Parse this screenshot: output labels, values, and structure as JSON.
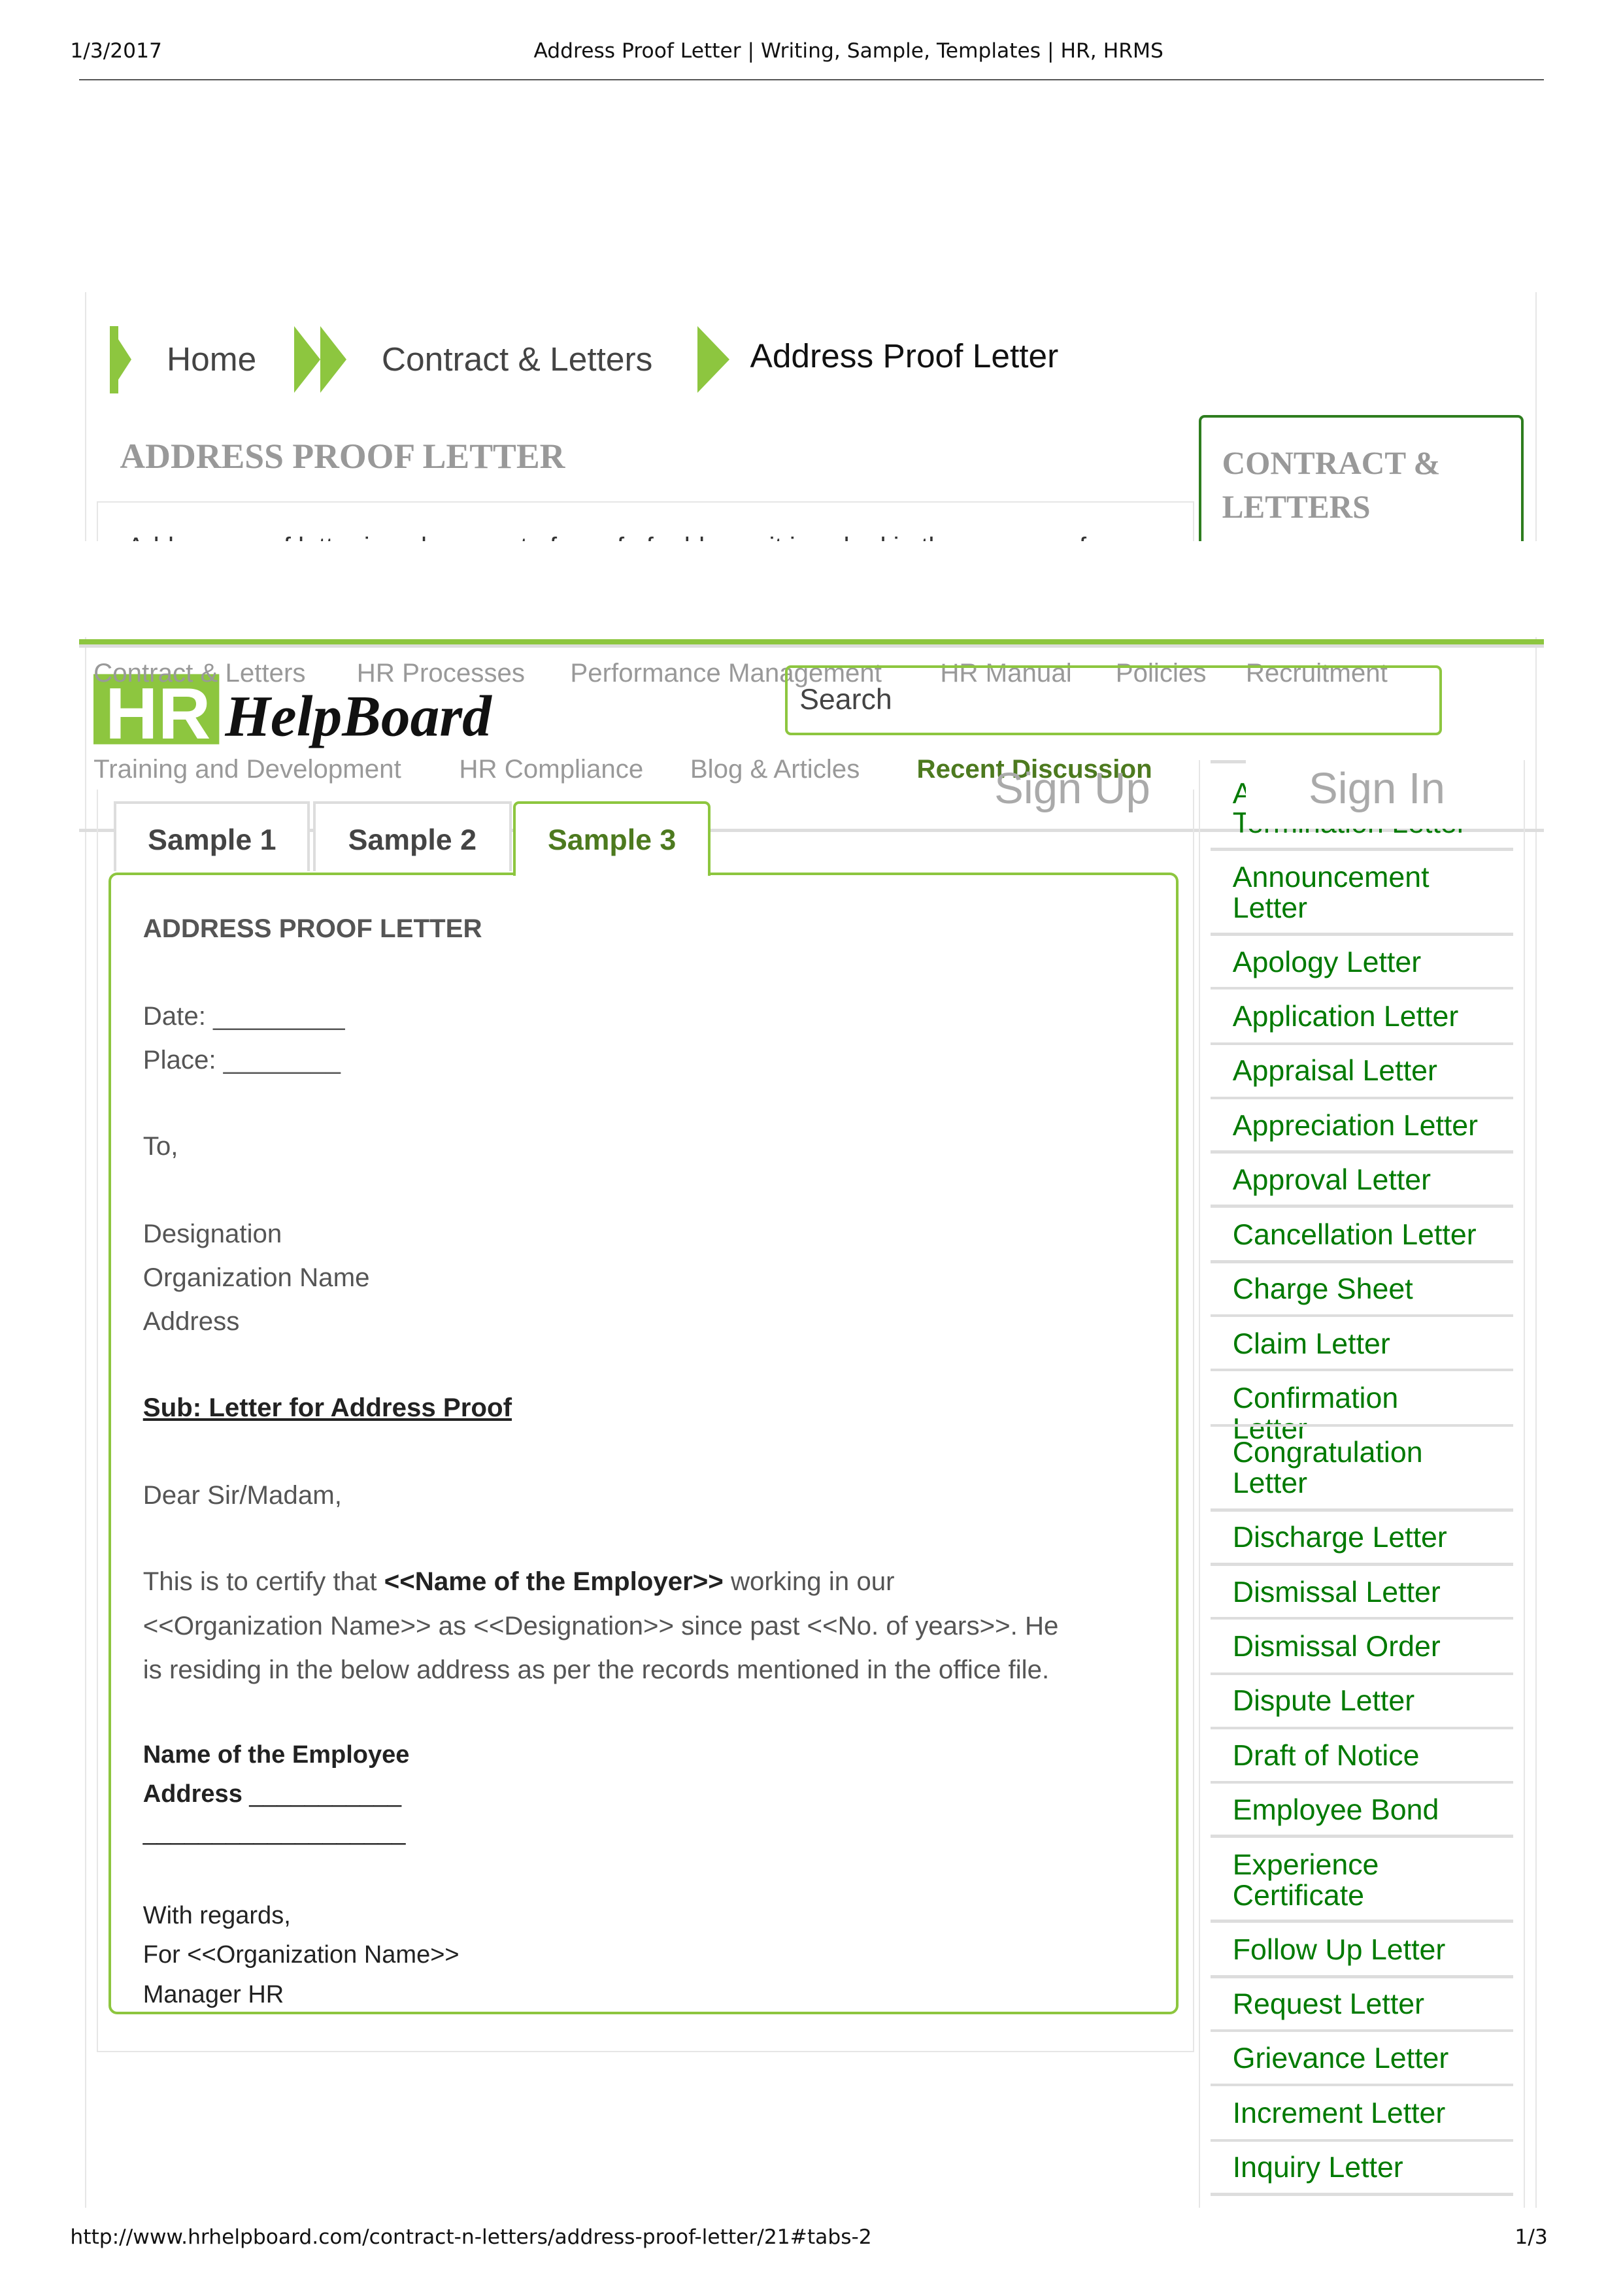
{
  "print_header": {
    "date": "1/3/2017",
    "title": "Address Proof Letter | Writing, Sample, Templates | HR, HRMS"
  },
  "breadcrumb": {
    "items": [
      "Home",
      "Contract & Letters",
      "Address Proof Letter"
    ]
  },
  "page_title": "ADDRESS PROOF LETTER",
  "intro_snippet": "Address proof letter is a document of proof of address, it is asked in the process of",
  "sidebar_title": "CONTRACT & LETTERS",
  "nav": {
    "row1": [
      "Contract & Letters",
      "HR Processes",
      "Performance Management",
      "HR Manual",
      "Policies",
      "Recruitment"
    ],
    "row2": [
      "Training and Development",
      "HR Compliance",
      "Blog & Articles",
      "Recent Discussion"
    ],
    "logo": "HR HelpBoard",
    "search_placeholder": "Search",
    "sign_up": "Sign Up",
    "sign_in": "Sign In"
  },
  "colors": {
    "brand_green": "#8dc63f",
    "link_green": "#007a00",
    "active_tab": "#4d7a1f"
  },
  "tabs": [
    "Sample 1",
    "Sample 2",
    "Sample 3"
  ],
  "active_tab": "Sample 3",
  "letter": {
    "heading": "ADDRESS PROOF LETTER",
    "date": "Date: _________",
    "place": "Place: ________",
    "to": "To,",
    "designation": "Designation",
    "org": "Organization Name",
    "address": "Address",
    "subject": "Sub: Letter for Address Proof",
    "salutation": "Dear Sir/Madam,",
    "body_pre": "This is to certify that ",
    "body_bold": "<<Name of the Employer>>",
    "body_post": " working in our",
    "body_line2": "<<Organization Name>> as <<Designation>> since past <<No. of years>>. He",
    "body_line3": "is residing in the below address as per the records mentioned in the office file.",
    "emp_name": "Name of the Employee",
    "emp_address": "Address",
    "emp_address_blank": " ___________",
    "blank_line": "___________________",
    "regards": "With regards,",
    "for_org": "For <<Organization Name>>",
    "signatory": "Manager HR"
  },
  "sidebar_items": [
    "A",
    "Termination Letter",
    "Announcement Letter",
    "Apology Letter",
    "Application Letter",
    "Appraisal Letter",
    "Appreciation Letter",
    "Approval Letter",
    "Cancellation Letter",
    "Charge Sheet",
    "Claim Letter",
    "Confirmation Letter",
    "Congratulation Letter",
    "Discharge Letter",
    "Dismissal Letter",
    "Dismissal Order",
    "Dispute Letter",
    "Draft of Notice",
    "Employee Bond",
    "Experience Certificate",
    "Follow Up Letter",
    "Request Letter",
    "Grievance Letter",
    "Increment Letter",
    "Inquiry Letter"
  ],
  "print_footer": {
    "url": "http://www.hrhelpboard.com/contract-n-letters/address-proof-letter/21#tabs-2",
    "page": "1/3"
  }
}
